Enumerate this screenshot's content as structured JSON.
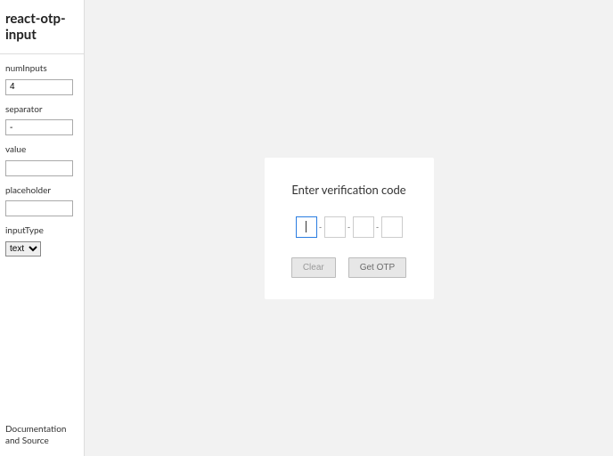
{
  "title": "react-otp-input",
  "fields": {
    "numInputs": {
      "label": "numInputs",
      "value": "4"
    },
    "separator": {
      "label": "separator",
      "value": "-"
    },
    "value": {
      "label": "value",
      "value": ""
    },
    "placeholder": {
      "label": "placeholder",
      "value": ""
    },
    "inputType": {
      "label": "inputType",
      "selected": "text"
    }
  },
  "footer": "Documentation and Source",
  "card": {
    "title": "Enter verification code",
    "separator": "-",
    "buttons": {
      "clear": "Clear",
      "getOtp": "Get OTP"
    }
  }
}
